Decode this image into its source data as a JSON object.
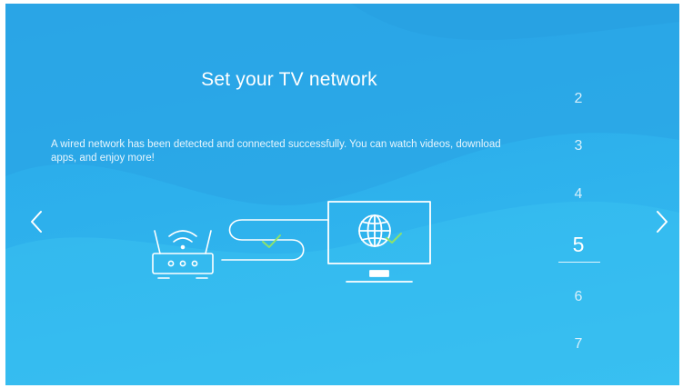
{
  "screen": {
    "title": "Set your TV network",
    "description": "A wired network has been detected and connected successfully. You can watch videos, download apps, and enjoy more!"
  },
  "navigation": {
    "prev_icon": "chevron-left-icon",
    "next_icon": "chevron-right-icon"
  },
  "steps": {
    "items": [
      "2",
      "3",
      "4",
      "5",
      "6",
      "7"
    ],
    "active": "5"
  },
  "illustration": {
    "router_icon": "wifi-router-icon",
    "tv_icon": "tv-globe-icon",
    "status_icon": "check-icon"
  },
  "colors": {
    "background": "#2db0ec",
    "accent_check": "#8ee26a",
    "line": "#ffffff"
  }
}
